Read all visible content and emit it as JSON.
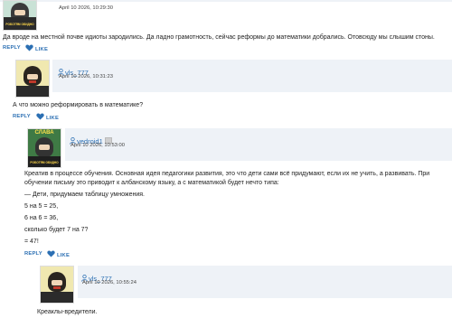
{
  "comments": [
    {
      "username": "",
      "date": "April 10 2026, 10:29:30",
      "avatar_caption": "РОБОТЯМ ОБИДНО",
      "text": [
        "Да вроде на местной почве идиоты зародились. Да ладно грамотность, сейчас реформы до математики добрались. Отовсюду мы слышим стоны."
      ],
      "reply_label": "REPLY",
      "like_label": "LIKE"
    },
    {
      "username": "vls_777",
      "date": "April 10 2026, 10:31:23",
      "text": [
        "А что можно реформировать в математике?"
      ],
      "reply_label": "REPLY",
      "like_label": "LIKE"
    },
    {
      "username": "vedroid1",
      "date": "April 10 2026, 10:53:00",
      "avatar_caption_top": "СЛАВА",
      "avatar_caption_bottom": "РОБОТЯМ ОБИДНО",
      "text": [
        "Креатив в процессе обучения. Основная идея педагогики развития, это что дети сами всё придумают, если их не учить, а развивать. При",
        "обучении письму это приводит к албанскому языку, а с математикой будет нечто типа:",
        "— Дети, придумаем таблицу умножения.",
        "5 на 5 = 25,",
        "6 на 6 = 36,",
        "сколько будет 7 на 7?",
        "= 47!"
      ],
      "reply_label": "REPLY",
      "like_label": "LIKE"
    },
    {
      "username": "vls_777",
      "date": "April 10 2026, 10:55:24",
      "text": [
        "Креаклы-вредители."
      ]
    }
  ],
  "colors": {
    "link": "#2b6fb3",
    "header_bg": "#eef2f7"
  },
  "icons": {
    "user": "user-icon",
    "like": "heart-icon",
    "badge": "badge-icon"
  }
}
